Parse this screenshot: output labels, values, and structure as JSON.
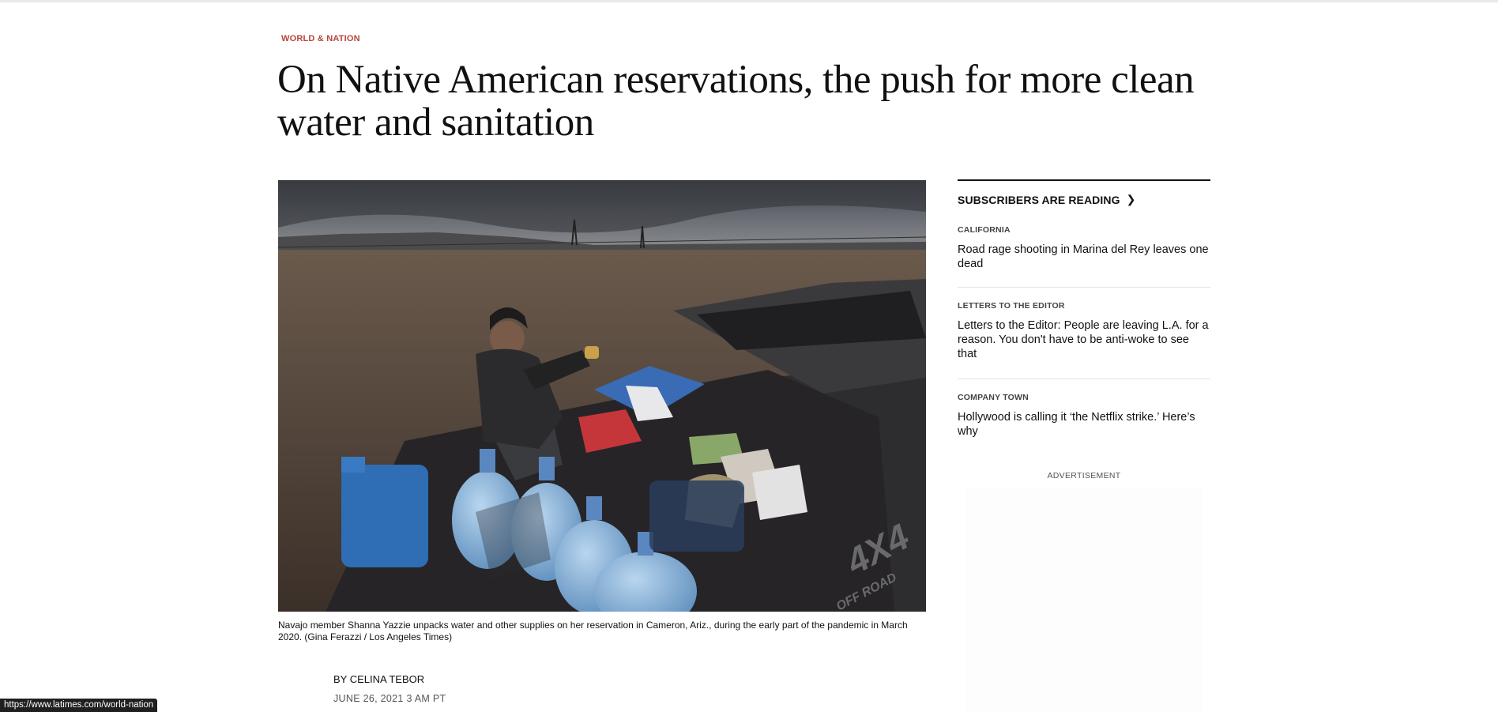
{
  "article": {
    "section": "WORLD & NATION",
    "headline": "On Native American reservations, the push for more clean water and sanitation",
    "caption": "Navajo member Shanna Yazzie unpacks water and other supplies on her reservation in Cameron, Ariz., during the early part of the pandemic in March 2020. (Gina Ferazzi / Los Angeles Times)",
    "byline_prefix": "BY",
    "author": "CELINA TEBOR",
    "date": "JUNE 26, 2021 3 AM PT",
    "photo_truck_text": "4X4",
    "photo_truck_sub": "OFF ROAD"
  },
  "sidebar": {
    "title": "SUBSCRIBERS ARE READING",
    "stories": [
      {
        "category": "CALIFORNIA",
        "title": "Road rage shooting in Marina del Rey leaves one dead"
      },
      {
        "category": "LETTERS TO THE EDITOR",
        "title": "Letters to the Editor: People are leaving L.A. for a reason. You don't have to be anti-woke to see that"
      },
      {
        "category": "COMPANY TOWN",
        "title": "Hollywood is calling it ‘the Netflix strike.’ Here’s why"
      }
    ],
    "ad_label": "ADVERTISEMENT"
  },
  "status_bar": {
    "url": "https://www.latimes.com/world-nation"
  },
  "colors": {
    "section": "#b5453a",
    "text": "#111111",
    "status_bg": "#1f1f1f"
  },
  "icons": {
    "sidebar_more": "chevron-right-icon"
  }
}
